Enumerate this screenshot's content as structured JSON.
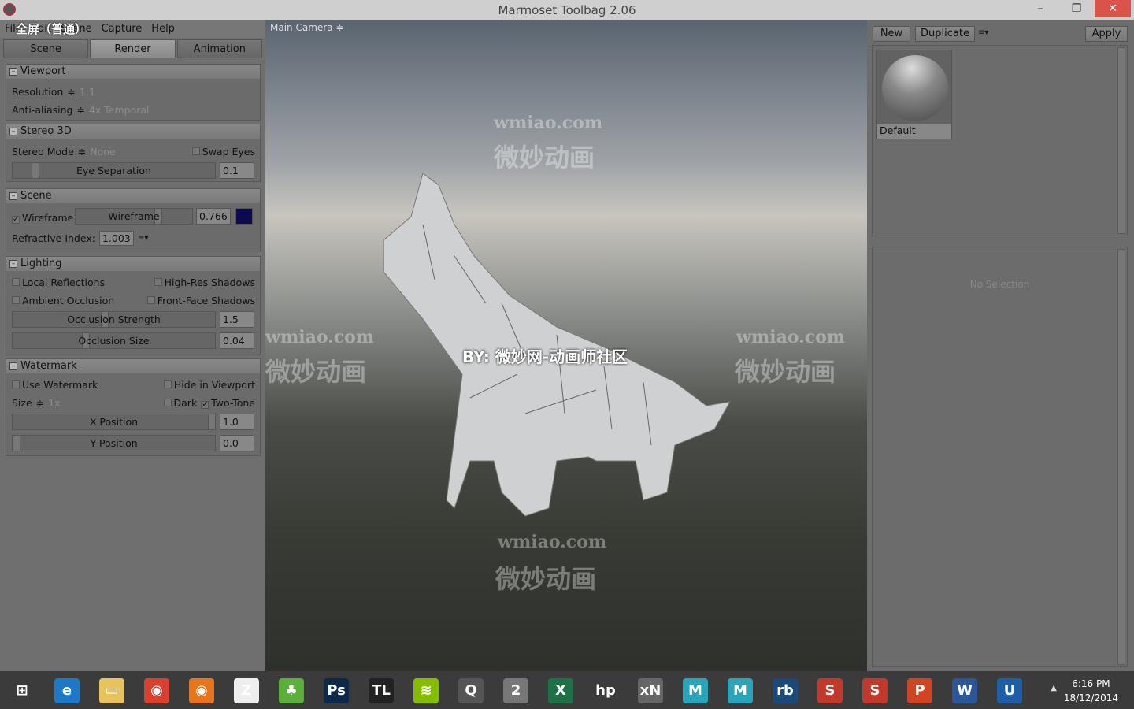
{
  "window": {
    "title": "Marmoset Toolbag 2.06",
    "minimize": "–",
    "restore": "❐",
    "close": "✕"
  },
  "menu": {
    "items": [
      "File",
      "Edit",
      "Scene",
      "Capture",
      "Help"
    ],
    "overlay": "全屏（普通）"
  },
  "tabs": [
    "Scene",
    "Render",
    "Animation"
  ],
  "active_tab": "Render",
  "viewport_section": {
    "title": "Viewport",
    "resolution_label": "Resolution",
    "resolution": "1:1",
    "aa_label": "Anti-aliasing",
    "aa": "4x Temporal"
  },
  "stereo": {
    "title": "Stereo 3D",
    "mode_label": "Stereo Mode",
    "mode": "None",
    "swap_eyes": "Swap Eyes",
    "eye_sep_label": "Eye Separation",
    "eye_sep": "0.1"
  },
  "scene": {
    "title": "Scene",
    "wireframe": "Wireframe",
    "wireframe_slider": "Wireframe",
    "wireframe_value": "0.766",
    "wireframe_color": "#0d0b4f",
    "refr_label": "Refractive Index:",
    "refr": "1.003",
    "menu_icon": "≡▾"
  },
  "lighting": {
    "title": "Lighting",
    "local_reflections": "Local Reflections",
    "high_res_shadows": "High-Res Shadows",
    "ambient_occlusion": "Ambient Occlusion",
    "front_face_shadows": "Front-Face Shadows",
    "occ_strength_label": "Occlusion Strength",
    "occ_strength": "1.5",
    "occ_size_label": "Occlusion Size",
    "occ_size": "0.04"
  },
  "watermark": {
    "title": "Watermark",
    "use": "Use Watermark",
    "hide": "Hide in Viewport",
    "size_label": "Size",
    "size": "1x",
    "dark": "Dark",
    "two_tone": "Two-Tone",
    "x_label": "X Position",
    "x": "1.0",
    "y_label": "Y Position",
    "y": "0.0"
  },
  "view": {
    "camera": "Main Camera ≑",
    "wm_en": "wmiao.com",
    "wm_cn": "微妙动画",
    "by": "BY: 微妙网-动画师社区"
  },
  "materials": {
    "new": "New",
    "duplicate": "Duplicate",
    "menu_icon": "≡▾",
    "apply": "Apply",
    "default": "Default",
    "no_selection": "No Selection"
  },
  "taskbar": {
    "apps": [
      {
        "name": "windows-start",
        "label": "⊞",
        "color": "#3b3b3b"
      },
      {
        "name": "internet-explorer",
        "label": "e",
        "color": "#1e78c8"
      },
      {
        "name": "file-explorer",
        "label": "▭",
        "color": "#e8c25a"
      },
      {
        "name": "chrome",
        "label": "◉",
        "color": "#d8402f"
      },
      {
        "name": "firefox",
        "label": "◉",
        "color": "#e8741c"
      },
      {
        "name": "zbrush",
        "label": "Z",
        "color": "#eee"
      },
      {
        "name": "topogun",
        "label": "♣",
        "color": "#5ab03a"
      },
      {
        "name": "photoshop",
        "label": "Ps",
        "color": "#0b2a4a"
      },
      {
        "name": "3d-coat",
        "label": "TL",
        "color": "#222"
      },
      {
        "name": "spotify",
        "label": "≋",
        "color": "#84bd00"
      },
      {
        "name": "quixel",
        "label": "Q",
        "color": "#555"
      },
      {
        "name": "marmoset",
        "label": "2",
        "color": "#777"
      },
      {
        "name": "excel",
        "label": "X",
        "color": "#1e7145"
      },
      {
        "name": "hp",
        "label": "hp",
        "color": "#3b3b3b"
      },
      {
        "name": "xnormal",
        "label": "xN",
        "color": "#666"
      },
      {
        "name": "maya-lt",
        "label": "M",
        "color": "#2aa4b8"
      },
      {
        "name": "maya",
        "label": "M",
        "color": "#2aa4b8"
      },
      {
        "name": "rizom",
        "label": "rb",
        "color": "#1b4a7a"
      },
      {
        "name": "substance-painter",
        "label": "S",
        "color": "#c0392b"
      },
      {
        "name": "substance-designer",
        "label": "S",
        "color": "#c0392b"
      },
      {
        "name": "powerpoint",
        "label": "P",
        "color": "#d04423"
      },
      {
        "name": "word",
        "label": "W",
        "color": "#2b579a"
      },
      {
        "name": "unreal",
        "label": "U",
        "color": "#1c5fa8"
      }
    ],
    "time": "6:16 PM",
    "date": "18/12/2014"
  }
}
